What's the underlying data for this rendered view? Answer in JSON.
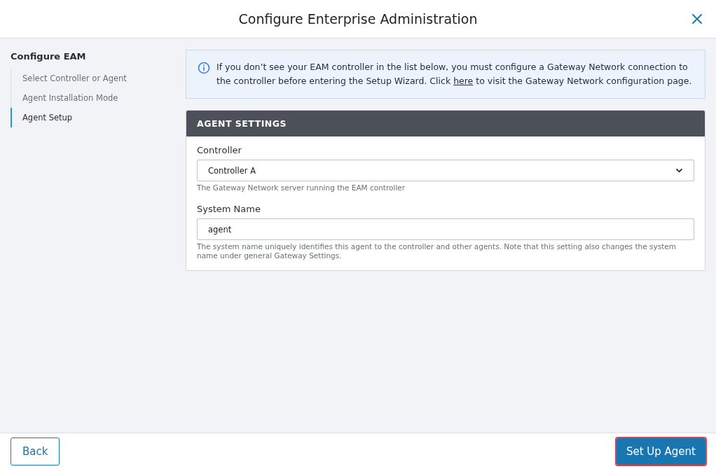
{
  "window": {
    "title": "Configure Enterprise Administration"
  },
  "sidebar": {
    "title": "Configure EAM",
    "steps": [
      {
        "label": "Select Controller or Agent",
        "selected": false
      },
      {
        "label": "Agent Installation Mode",
        "selected": false
      },
      {
        "label": "Agent Setup",
        "selected": true
      }
    ]
  },
  "info": {
    "text_before": "If you don’t see your EAM controller in the list below, you must configure a Gateway Network connection to the controller before entering the Setup Wizard. Click ",
    "link": "here",
    "text_after": " to visit the Gateway Network configuration page."
  },
  "panel": {
    "title": "AGENT SETTINGS",
    "fields": [
      {
        "kind": "select",
        "label": "Controller",
        "value": "Controller A",
        "help": "The Gateway Network server running the EAM controller"
      },
      {
        "kind": "text",
        "label": "System Name",
        "value": "agent",
        "help": "The system name uniquely identifies this agent to the controller and other agents. Note that this setting also changes the system name under general Gateway Settings."
      }
    ]
  },
  "footer": {
    "back": "Back",
    "primary": {
      "label": "Set Up Agent",
      "highlighted": true
    }
  }
}
